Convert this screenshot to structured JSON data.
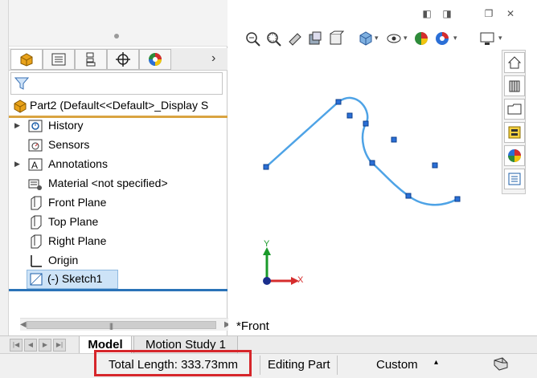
{
  "feature_manager": {
    "part_label": "Part2  (Default<<Default>_Display S",
    "tree": [
      {
        "label": "History",
        "expandable": true
      },
      {
        "label": "Sensors",
        "expandable": false
      },
      {
        "label": "Annotations",
        "expandable": true
      },
      {
        "label": "Material <not specified>",
        "expandable": false
      },
      {
        "label": "Front Plane",
        "expandable": false
      },
      {
        "label": "Top Plane",
        "expandable": false
      },
      {
        "label": "Right Plane",
        "expandable": false
      },
      {
        "label": "Origin",
        "expandable": false
      },
      {
        "label": "(-) Sketch1",
        "expandable": false,
        "selected": true
      }
    ],
    "tabs": [
      "feature-manager",
      "property-manager",
      "configuration-manager",
      "dimxpert-manager",
      "display-manager"
    ]
  },
  "graphics": {
    "view_label": "*Front",
    "triad": {
      "x_label": "X",
      "y_label": "Y"
    },
    "sketch_color": "#4ea3e6"
  },
  "bottom_tabs": {
    "model": "Model",
    "motion_study": "Motion Study 1"
  },
  "status_bar": {
    "total_length": "Total Length: 333.73mm",
    "mode": "Editing Part",
    "units": "Custom",
    "highlight_color": "#d6262b"
  },
  "task_pane": [
    "home-icon",
    "design-library-icon",
    "file-explorer-icon",
    "view-palette-icon",
    "appearances-icon",
    "custom-properties-icon"
  ],
  "window_controls": [
    "restore-icon",
    "close-icon"
  ]
}
